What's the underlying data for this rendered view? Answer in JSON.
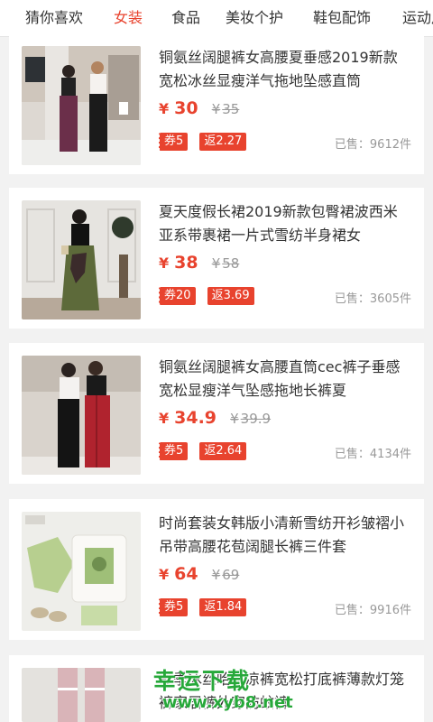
{
  "tabs": [
    "猜你喜欢",
    "女装",
    "食品",
    "美妆个护",
    "鞋包配饰",
    "运动户外"
  ],
  "active_tab": "女装",
  "products": [
    {
      "title": "铜氨丝阔腿裤女高腰夏垂感2019新款宽松冰丝显瘦洋气拖地坠感直筒",
      "price": "30",
      "old_price": "35",
      "coupon": "券5",
      "rebate": "返2.27",
      "sold": "已售：9612件"
    },
    {
      "title": "夏天度假长裙2019新款包臀裙波西米亚系带裹裙一片式雪纺半身裙女",
      "price": "38",
      "old_price": "58",
      "coupon": "券20",
      "rebate": "返3.69",
      "sold": "已售：3605件"
    },
    {
      "title": "铜氨丝阔腿裤女高腰直筒cec裤子垂感宽松显瘦洋气坠感拖地长裤夏",
      "price": "34.9",
      "old_price": "39.9",
      "coupon": "券5",
      "rebate": "返2.64",
      "sold": "已售：4134件"
    },
    {
      "title": "时尚套装女韩版小清新雪纺开衫皱褶小吊带高腰花苞阔腿长裤三件套",
      "price": "64",
      "old_price": "69",
      "coupon": "券5",
      "rebate": "返1.84",
      "sold": "已售：9916件"
    },
    {
      "title": "夏季冰丝哈伦凉裤宽松打底裤薄款灯笼裤家居裤外穿防蚊裤"
    }
  ],
  "currency": "¥",
  "watermark": {
    "text": "幸运下载",
    "url": "www.xyb8.net"
  },
  "colors": {
    "accent": "#e8432e",
    "watermark": "#27a83a"
  }
}
